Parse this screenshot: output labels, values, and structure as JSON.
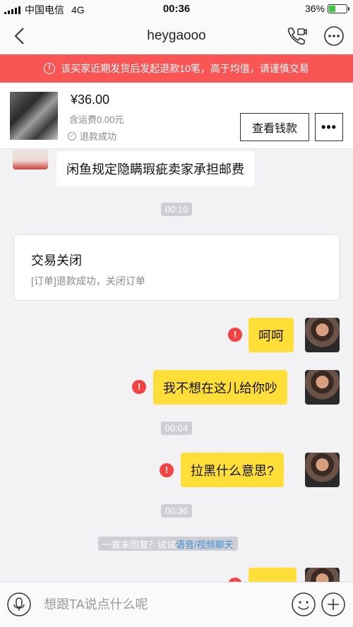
{
  "status_bar": {
    "carrier": "中国电信",
    "network": "4G",
    "time": "00:36",
    "battery": "36%",
    "battery_level": 0.36
  },
  "navbar": {
    "title": "heygaooo"
  },
  "warning": {
    "text": "该买家近期发货后发起退款10笔，高于均值，请谨慎交易"
  },
  "product": {
    "price": "¥36.00",
    "shipping": "含运费0.00元",
    "status": "退款成功",
    "view_money_label": "查看钱款",
    "more_label": "•••"
  },
  "chat": {
    "incoming_message": "闲鱼规定隐瞒瑕疵卖家承担邮费",
    "timestamps": [
      "00:10",
      "00:04",
      "00:36"
    ],
    "card": {
      "title": "交易关闭",
      "desc": "[订单]退款成功，关闭订单"
    },
    "messages": [
      "呵呵",
      "我不想在这儿给你吵",
      "拉黑什么意思?"
    ],
    "tip": {
      "prefix": "一直未回复？试试",
      "link": "语音/视频聊天"
    }
  },
  "input": {
    "placeholder": "想跟TA说点什么呢"
  },
  "colors": {
    "warning_bg": "#f95555",
    "my_bubble": "#ffde38",
    "alert": "#f24242"
  }
}
